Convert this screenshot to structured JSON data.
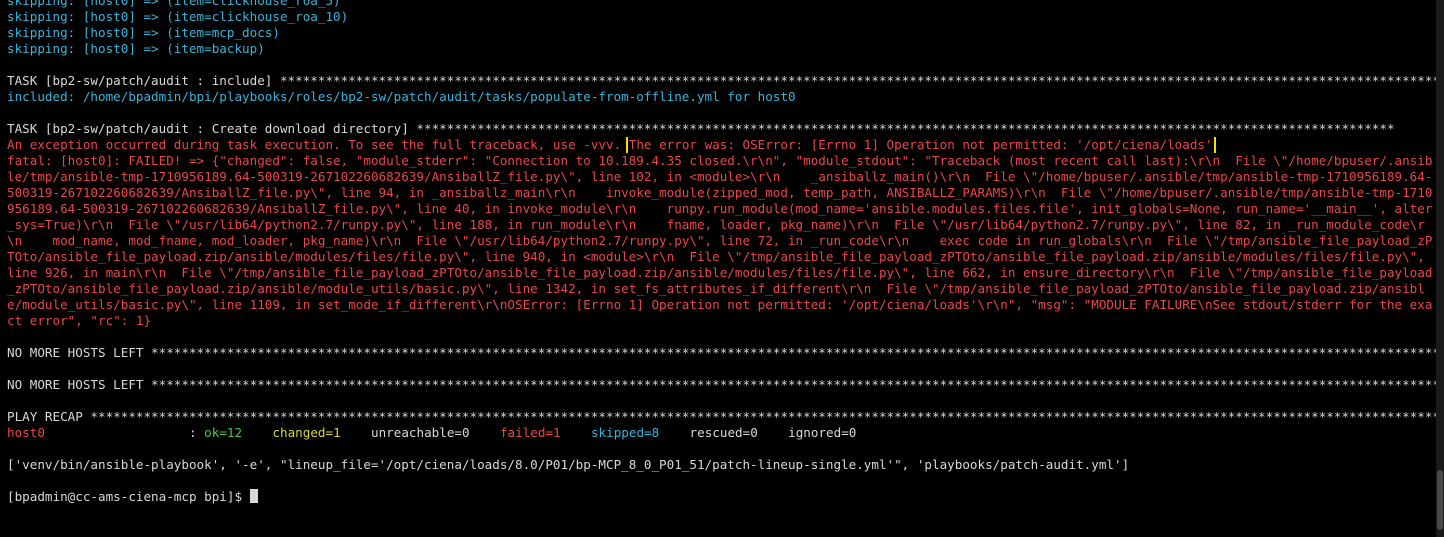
{
  "skipping_lines": [
    "skipping: [host0] => (item=clickhouse_roa_5)",
    "skipping: [host0] => (item=clickhouse_roa_10)",
    "skipping: [host0] => (item=mcp_docs)",
    "skipping: [host0] => (item=backup)"
  ],
  "task_include": {
    "header": "TASK [bp2-sw/patch/audit : include] ***************************************************************************************************************************************************************",
    "included": "included: /home/bpadmin/bpi/playbooks/roles/bp2-sw/patch/audit/tasks/populate-from-offline.yml for host0"
  },
  "task_create": {
    "header": "TASK [bp2-sw/patch/audit : Create download directory] *********************************************************************************************************************************",
    "exception_prefix": "An exception occurred during task execution. To see the full traceback, use -vvv.",
    "error_highlight": "The error was: OSError: [Errno 1] Operation not permitted: '/opt/ciena/loads'",
    "fatal_text": "fatal: [host0]: FAILED! => {\"changed\": false, \"module_stderr\": \"Connection to 10.189.4.35 closed.\\r\\n\", \"module_stdout\": \"Traceback (most recent call last):\\r\\n  File \\\"/home/bpuser/.ansible/tmp/ansible-tmp-1710956189.64-500319-267102260682639/AnsiballZ_file.py\\\", line 102, in <module>\\r\\n    _ansiballz_main()\\r\\n  File \\\"/home/bpuser/.ansible/tmp/ansible-tmp-1710956189.64-500319-267102260682639/AnsiballZ_file.py\\\", line 94, in _ansiballz_main\\r\\n    invoke_module(zipped_mod, temp_path, ANSIBALLZ_PARAMS)\\r\\n  File \\\"/home/bpuser/.ansible/tmp/ansible-tmp-1710956189.64-500319-267102260682639/AnsiballZ_file.py\\\", line 40, in invoke_module\\r\\n    runpy.run_module(mod_name='ansible.modules.files.file', init_globals=None, run_name='__main__', alter_sys=True)\\r\\n  File \\\"/usr/lib64/python2.7/runpy.py\\\", line 188, in run_module\\r\\n    fname, loader, pkg_name)\\r\\n  File \\\"/usr/lib64/python2.7/runpy.py\\\", line 82, in _run_module_code\\r\\n    mod_name, mod_fname, mod_loader, pkg_name)\\r\\n  File \\\"/usr/lib64/python2.7/runpy.py\\\", line 72, in _run_code\\r\\n    exec code in run_globals\\r\\n  File \\\"/tmp/ansible_file_payload_zPTOto/ansible_file_payload.zip/ansible/modules/files/file.py\\\", line 940, in <module>\\r\\n  File \\\"/tmp/ansible_file_payload_zPTOto/ansible_file_payload.zip/ansible/modules/files/file.py\\\", line 926, in main\\r\\n  File \\\"/tmp/ansible_file_payload_zPTOto/ansible_file_payload.zip/ansible/modules/files/file.py\\\", line 662, in ensure_directory\\r\\n  File \\\"/tmp/ansible_file_payload_zPTOto/ansible_file_payload.zip/ansible/module_utils/basic.py\\\", line 1342, in set_fs_attributes_if_different\\r\\n  File \\\"/tmp/ansible_file_payload_zPTOto/ansible_file_payload.zip/ansible/module_utils/basic.py\\\", line 1109, in set_mode_if_different\\r\\nOSError: [Errno 1] Operation not permitted: '/opt/ciena/loads'\\r\\n\", \"msg\": \"MODULE FAILURE\\nSee stdout/stderr for the exact error\", \"rc\": 1}"
  },
  "no_more_hosts_1": "NO MORE HOSTS LEFT ****************************************************************************************************************************************************************************",
  "no_more_hosts_2": "NO MORE HOSTS LEFT ****************************************************************************************************************************************************************************",
  "play_recap": {
    "header": "PLAY RECAP ************************************************************************************************************************************************************************************",
    "host": "host0",
    "sep": "                   : ",
    "ok": "ok=12",
    "changed": "changed=1",
    "unreachable": "unreachable=0",
    "failed": "failed=1",
    "skipped": "skipped=8",
    "rescued": "rescued=0",
    "ignored": "ignored=0"
  },
  "command_echo": "['venv/bin/ansible-playbook', '-e', \"lineup_file='/opt/ciena/loads/8.0/P01/bp-MCP_8_0_P01_51/patch-lineup-single.yml'\", 'playbooks/patch-audit.yml']",
  "prompt": "[bpadmin@cc-ams-ciena-mcp bpi]$ ",
  "colors": {
    "background": "#000000",
    "cyan": "#3bb3d8",
    "red": "#e8474a",
    "green": "#4ec94e",
    "yellow": "#d6d63a",
    "highlight_box": "#f2e000",
    "text": "#d8d8d8"
  }
}
